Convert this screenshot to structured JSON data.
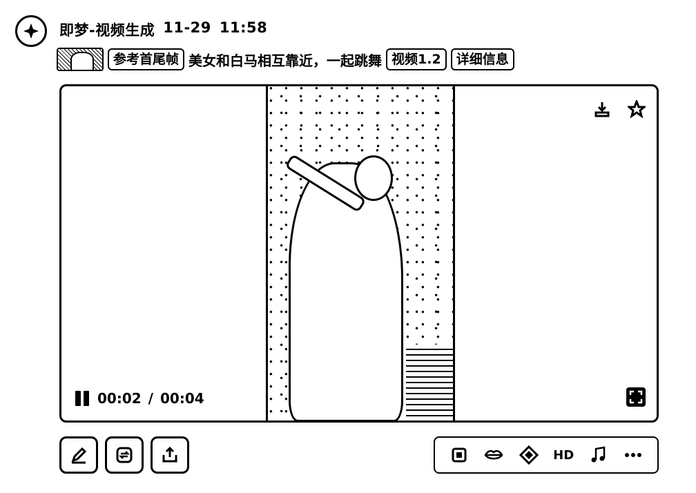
{
  "header": {
    "app_title": "即梦-视频生成",
    "date": "11-29",
    "time": "11:58"
  },
  "prompt": {
    "thumbnail_label": "",
    "mode_tag": "参考首尾帧",
    "text": "美女和白马相互靠近，一起跳舞",
    "model_tag": "视频1.2",
    "details_button": "详细信息"
  },
  "player": {
    "current_time": "00:02",
    "separator": "/",
    "duration": "00:04",
    "icons": {
      "download": "download-icon",
      "favorite": "star-icon",
      "pause": "pause-icon",
      "fullscreen": "fullscreen-icon"
    }
  },
  "actions": {
    "left": [
      "edit-icon",
      "regenerate-icon",
      "share-icon"
    ],
    "toolbar": {
      "frame_icon": "frame-icon",
      "lip_sync_icon": "lips-icon",
      "effect_icon": "diamond-icon",
      "hd_label": "HD",
      "music_icon": "music-icon",
      "more_icon": "more-icon"
    }
  }
}
